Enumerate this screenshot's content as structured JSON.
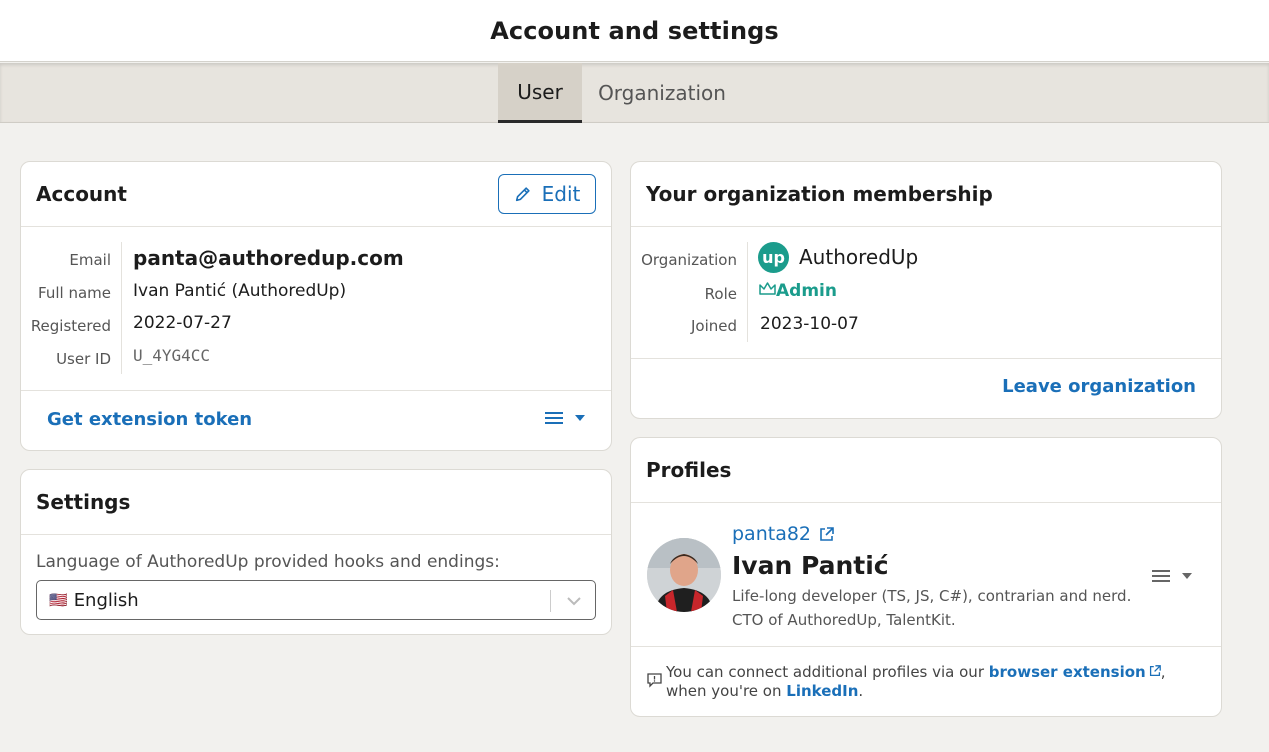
{
  "header": {
    "title": "Account and settings"
  },
  "tabs": [
    {
      "label": "User"
    },
    {
      "label": "Organization"
    }
  ],
  "account": {
    "title": "Account",
    "edit_label": "Edit",
    "fields": [
      {
        "label": "Email",
        "value": "panta@authoredup.com"
      },
      {
        "label": "Full name",
        "value": "Ivan Pantić (AuthoredUp)"
      },
      {
        "label": "Registered",
        "value": "2022-07-27"
      },
      {
        "label": "User ID",
        "value": "U_4YG4CC"
      }
    ],
    "token_link": "Get extension token"
  },
  "settings": {
    "title": "Settings",
    "language_label": "Language of AuthoredUp provided hooks and endings:",
    "language_flag": "🇺🇸",
    "language_value": "English"
  },
  "membership": {
    "title": "Your organization membership",
    "org_label": "Organization",
    "org_value": "AuthoredUp",
    "org_logo_text": "up",
    "role_label": "Role",
    "role_value": "Admin",
    "joined_label": "Joined",
    "joined_value": "2023-10-07",
    "leave_link": "Leave organization"
  },
  "profiles": {
    "title": "Profiles",
    "handle": "panta82",
    "name": "Ivan Pantić",
    "bio_line1": "Life-long developer (TS, JS, C#), contrarian and nerd.",
    "bio_line2": "CTO of AuthoredUp, TalentKit.",
    "note_prefix": "You can connect additional profiles via our",
    "note_link1": "browser extension",
    "note_middle": ", when you're on",
    "note_link2": "LinkedIn",
    "note_suffix": "."
  },
  "colors": {
    "accent": "#1a6fb8",
    "teal": "#1b9c8c",
    "bg": "#f2f1ee"
  }
}
